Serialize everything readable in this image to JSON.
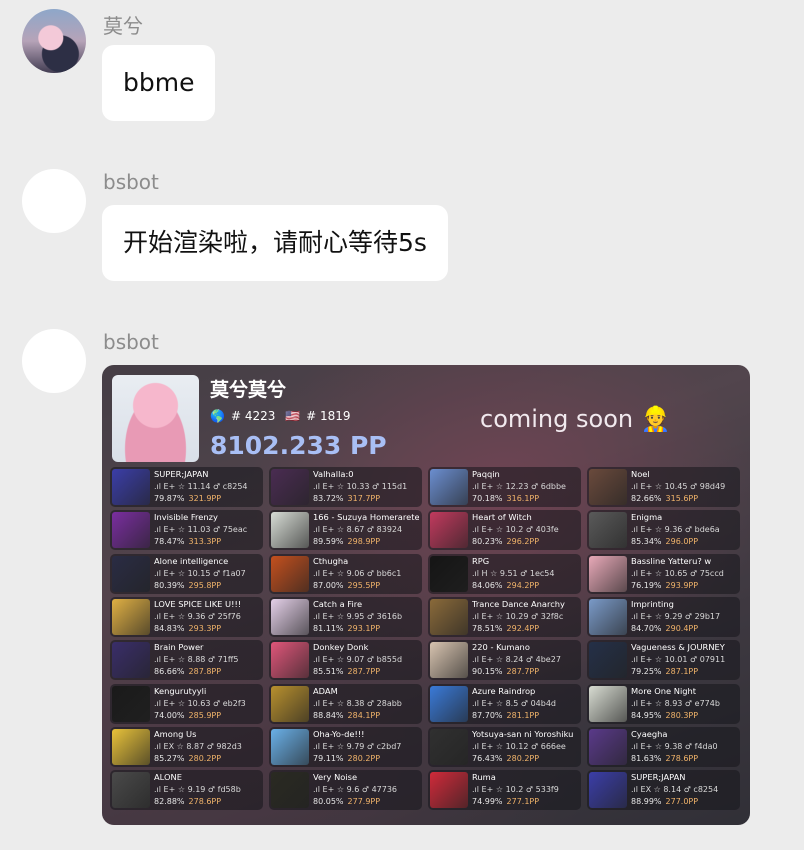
{
  "messages": [
    {
      "sender": "莫兮",
      "text": "bbme"
    },
    {
      "sender": "bsbot",
      "text": "开始渲染啦，请耐心等待5s"
    },
    {
      "sender": "bsbot"
    }
  ],
  "card": {
    "player_name": "莫兮莫兮",
    "global_rank": "# 4223",
    "country_rank": "# 1819",
    "total_pp": "8102.233 PP",
    "coming_soon": "coming soon 👷",
    "scores": [
      {
        "title": "SUPER;JAPAN",
        "diff": "E+",
        "stars": "11.14",
        "hash": "c8254",
        "acc": "79.87%",
        "pp": "321.9PP",
        "color": "#3b3ea8"
      },
      {
        "title": "Valhalla:0",
        "diff": "E+",
        "stars": "10.33",
        "hash": "115d1",
        "acc": "83.72%",
        "pp": "317.7PP",
        "color": "#4a2c52"
      },
      {
        "title": "Paqqin",
        "diff": "E+",
        "stars": "12.23",
        "hash": "6dbbe",
        "acc": "70.18%",
        "pp": "316.1PP",
        "color": "#6b8ed0"
      },
      {
        "title": "Noel",
        "diff": "E+",
        "stars": "10.45",
        "hash": "98d49",
        "acc": "82.66%",
        "pp": "315.6PP",
        "color": "#6a4a3c"
      },
      {
        "title": "Invisible Frenzy",
        "diff": "E+",
        "stars": "11.03",
        "hash": "75eac",
        "acc": "78.47%",
        "pp": "313.3PP",
        "color": "#7a2ea0"
      },
      {
        "title": "166 - Suzuya Homerarete...",
        "diff": "E+",
        "stars": "8.67",
        "hash": "83924",
        "acc": "89.59%",
        "pp": "298.9PP",
        "color": "#d8ddd6"
      },
      {
        "title": "Heart of Witch",
        "diff": "E+",
        "stars": "10.2",
        "hash": "403fe",
        "acc": "80.23%",
        "pp": "296.2PP",
        "color": "#c23a5e"
      },
      {
        "title": "Enigma",
        "diff": "E+",
        "stars": "9.36",
        "hash": "bde6a",
        "acc": "85.34%",
        "pp": "296.0PP",
        "color": "#5a5a5a"
      },
      {
        "title": "Alone intelligence",
        "diff": "E+",
        "stars": "10.15",
        "hash": "f1a07",
        "acc": "80.39%",
        "pp": "295.8PP",
        "color": "#2a2c44"
      },
      {
        "title": "Cthugha",
        "diff": "E+",
        "stars": "9.06",
        "hash": "bb6c1",
        "acc": "87.00%",
        "pp": "295.5PP",
        "color": "#c4501e"
      },
      {
        "title": "RPG",
        "diff": "H",
        "stars": "9.51",
        "hash": "1ec54",
        "acc": "84.06%",
        "pp": "294.2PP",
        "color": "#151515"
      },
      {
        "title": "Bassline Yatteru? w",
        "diff": "E+",
        "stars": "10.65",
        "hash": "75ccd",
        "acc": "76.19%",
        "pp": "293.9PP",
        "color": "#e8a9b8"
      },
      {
        "title": "LOVE SPICE LIKE U!!!",
        "diff": "E+",
        "stars": "9.36",
        "hash": "25f76",
        "acc": "84.83%",
        "pp": "293.3PP",
        "color": "#e0b044"
      },
      {
        "title": "Catch a Fire",
        "diff": "E+",
        "stars": "9.95",
        "hash": "3616b",
        "acc": "81.11%",
        "pp": "293.1PP",
        "color": "#e4d0e8"
      },
      {
        "title": "Trance Dance Anarchy",
        "diff": "E+",
        "stars": "10.29",
        "hash": "32f8c",
        "acc": "78.51%",
        "pp": "292.4PP",
        "color": "#8a6a3a"
      },
      {
        "title": "Imprinting",
        "diff": "E+",
        "stars": "9.29",
        "hash": "29b17",
        "acc": "84.70%",
        "pp": "290.4PP",
        "color": "#7a9ac8"
      },
      {
        "title": "Brain Power",
        "diff": "E+",
        "stars": "8.88",
        "hash": "71ff5",
        "acc": "86.66%",
        "pp": "287.8PP",
        "color": "#3a2e6a"
      },
      {
        "title": "Donkey Donk",
        "diff": "E+",
        "stars": "9.07",
        "hash": "b855d",
        "acc": "85.51%",
        "pp": "287.7PP",
        "color": "#e0567a"
      },
      {
        "title": "220 - Kumano",
        "diff": "E+",
        "stars": "8.24",
        "hash": "4be27",
        "acc": "90.15%",
        "pp": "287.7PP",
        "color": "#d8c4b0"
      },
      {
        "title": "Vagueness & JOURNEY",
        "diff": "E+",
        "stars": "10.01",
        "hash": "07911",
        "acc": "79.25%",
        "pp": "287.1PP",
        "color": "#243048"
      },
      {
        "title": "Kengurutyyli",
        "diff": "E+",
        "stars": "10.63",
        "hash": "eb2f3",
        "acc": "74.00%",
        "pp": "285.9PP",
        "color": "#1a1a1a"
      },
      {
        "title": "ADAM",
        "diff": "E+",
        "stars": "8.38",
        "hash": "28abb",
        "acc": "88.84%",
        "pp": "284.1PP",
        "color": "#b8902e"
      },
      {
        "title": "Azure Raindrop",
        "diff": "E+",
        "stars": "8.5",
        "hash": "04b4d",
        "acc": "87.70%",
        "pp": "281.1PP",
        "color": "#3a7ad8"
      },
      {
        "title": "More One Night",
        "diff": "E+",
        "stars": "8.93",
        "hash": "e774b",
        "acc": "84.95%",
        "pp": "280.3PP",
        "color": "#d8dcd2"
      },
      {
        "title": "Among Us",
        "diff": "EX",
        "stars": "8.87",
        "hash": "982d3",
        "acc": "85.27%",
        "pp": "280.2PP",
        "color": "#e8c23a"
      },
      {
        "title": "Oha-Yo-de!!!",
        "diff": "E+",
        "stars": "9.79",
        "hash": "c2bd7",
        "acc": "79.11%",
        "pp": "280.2PP",
        "color": "#6ab0e8"
      },
      {
        "title": "Yotsuya-san ni Yoroshiku",
        "diff": "E+",
        "stars": "10.12",
        "hash": "666ee",
        "acc": "76.43%",
        "pp": "280.2PP",
        "color": "#303030"
      },
      {
        "title": "Cyaegha",
        "diff": "E+",
        "stars": "9.38",
        "hash": "f4da0",
        "acc": "81.63%",
        "pp": "278.6PP",
        "color": "#5a3a8a"
      },
      {
        "title": "ALONE",
        "diff": "E+",
        "stars": "9.19",
        "hash": "fd58b",
        "acc": "82.88%",
        "pp": "278.6PP",
        "color": "#4a4a4a"
      },
      {
        "title": "Very Noise",
        "diff": "E+",
        "stars": "9.6",
        "hash": "47736",
        "acc": "80.05%",
        "pp": "277.9PP",
        "color": "#2a2a22"
      },
      {
        "title": "Ruma",
        "diff": "E+",
        "stars": "10.2",
        "hash": "533f9",
        "acc": "74.99%",
        "pp": "277.1PP",
        "color": "#d02a3a"
      },
      {
        "title": "SUPER;JAPAN",
        "diff": "EX",
        "stars": "8.14",
        "hash": "c8254",
        "acc": "88.99%",
        "pp": "277.0PP",
        "color": "#3b3ea8"
      }
    ]
  }
}
